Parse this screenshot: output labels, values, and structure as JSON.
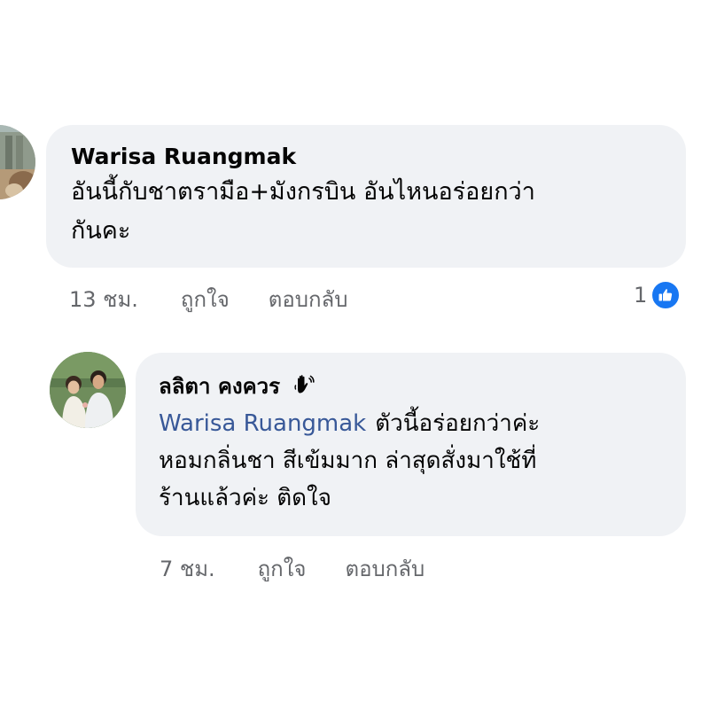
{
  "comment": {
    "author": "Warisa Ruangmak",
    "text_lines": [
      "อันนี้กับชาตรามือ+มังกรบิน อันไหนอร่อยกว่า",
      "กันคะ"
    ],
    "timestamp": "13 ชม.",
    "like_label": "ถูกใจ",
    "reply_label": "ตอบกลับ",
    "reaction_count": "1",
    "reaction_icon": "thumbs-up-icon"
  },
  "reply": {
    "author": "ลลิตา คงควร",
    "author_icon": "waving-hand-icon",
    "mention": "Warisa Ruangmak",
    "text_lines": [
      "ตัวนี้อร่อยกว่าค่ะ",
      "หอมกลิ่นชา สีเข้มมาก  ล่าสุดสั่งมาใช้ที่",
      "ร้านแล้วค่ะ  ติดใจ"
    ],
    "timestamp": "7 ชม.",
    "like_label": "ถูกใจ",
    "reply_label": "ตอบกลับ"
  },
  "colors": {
    "bubble": "#f0f2f5",
    "mention": "#385898",
    "secondary_text": "#65676b",
    "like_blue": "#1877f2"
  }
}
